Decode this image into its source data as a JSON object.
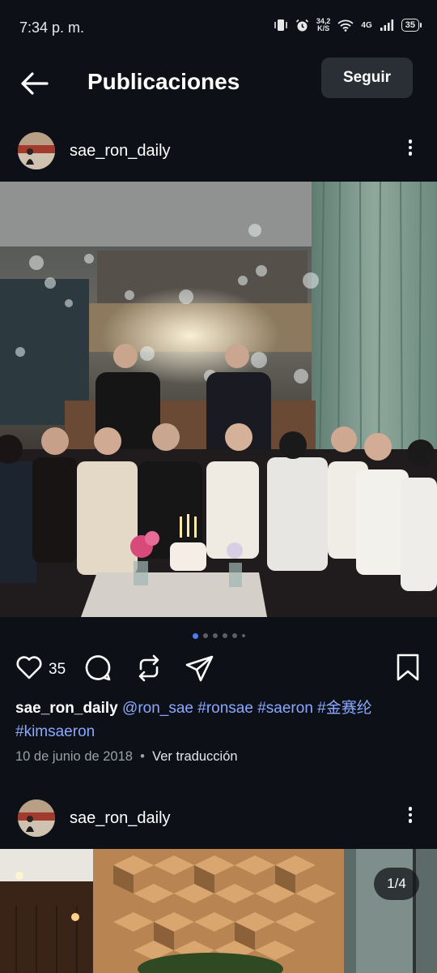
{
  "status_bar": {
    "time": "7:34 p. m.",
    "speed_value": "34,2",
    "speed_unit": "K/S",
    "network": "4G",
    "battery": "35"
  },
  "header": {
    "title": "Publicaciones",
    "follow_label": "Seguir"
  },
  "posts": [
    {
      "username": "sae_ron_daily",
      "likes": "35",
      "carousel": {
        "total_dots": 6,
        "active_index": 0
      },
      "caption": {
        "user": "sae_ron_daily",
        "tags": [
          "@ron_sae",
          "#ronsae",
          "#saeron",
          "#金赛纶",
          "#kimsaeron"
        ]
      },
      "date": "10 de junio de 2018",
      "separator": "•",
      "translate_label": "Ver traducción"
    },
    {
      "username": "sae_ron_daily",
      "counter": "1/4"
    }
  ]
}
